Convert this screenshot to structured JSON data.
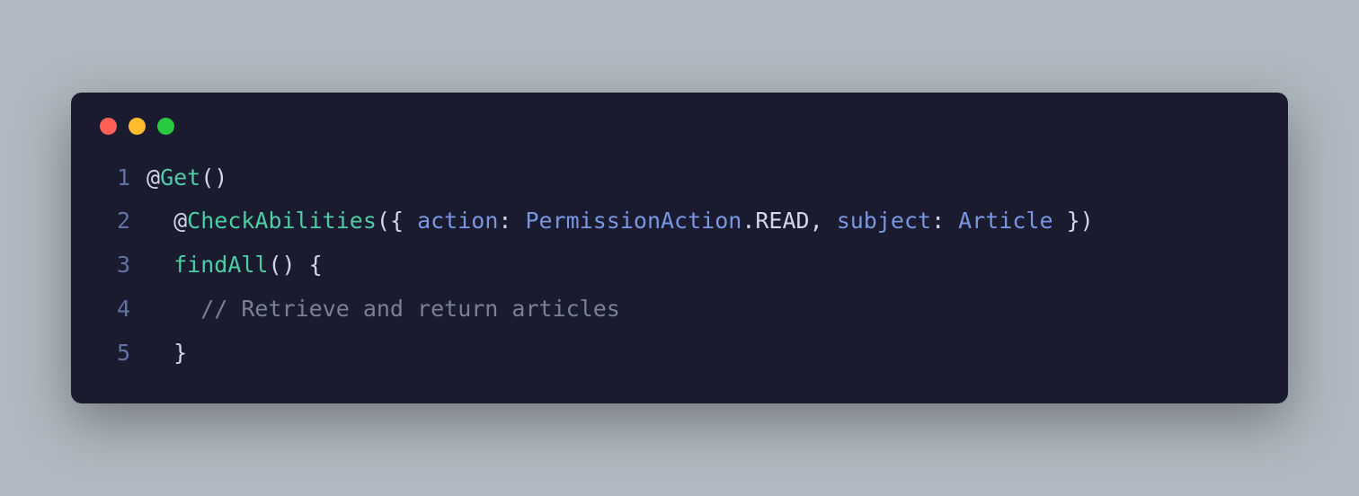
{
  "lineNumbers": [
    "1",
    "2",
    "3",
    "4",
    "5"
  ],
  "line1": {
    "at": "@",
    "decorator": "Get",
    "parens": "()"
  },
  "line2": {
    "indent": "  ",
    "at": "@",
    "decorator": "CheckAbilities",
    "openParen": "(",
    "openBrace": "{ ",
    "prop1": "action",
    "colon1": ": ",
    "class1": "PermissionAction",
    "dot": ".",
    "constant": "READ",
    "comma": ", ",
    "prop2": "subject",
    "colon2": ": ",
    "class2": "Article",
    "closeBrace": " }",
    "closeParen": ")"
  },
  "line3": {
    "indent": "  ",
    "func": "findAll",
    "parens": "()",
    "brace": " {"
  },
  "line4": {
    "indent": "    ",
    "comment": "// Retrieve and return articles"
  },
  "line5": {
    "indent": "  ",
    "brace": "}"
  }
}
